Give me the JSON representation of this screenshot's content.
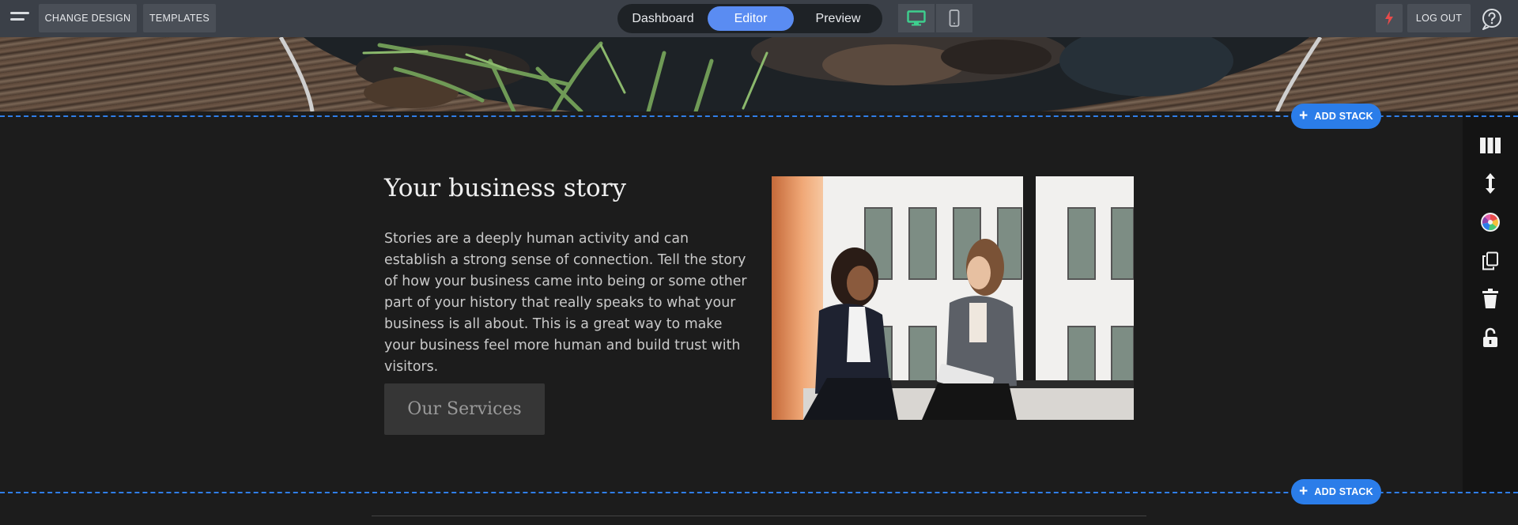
{
  "toolbar": {
    "change_design_label": "CHANGE DESIGN",
    "templates_label": "TEMPLATES",
    "modes": [
      {
        "label": "Dashboard",
        "active": false
      },
      {
        "label": "Editor",
        "active": true
      },
      {
        "label": "Preview",
        "active": false
      }
    ],
    "devices": [
      "desktop-icon",
      "mobile-icon"
    ],
    "active_device": "desktop",
    "logout_label": "LOG OUT",
    "icons": [
      "menu-icon",
      "lightning-icon",
      "help-icon"
    ]
  },
  "stack_controls": {
    "add_stack_label": "ADD STACK"
  },
  "content": {
    "heading": "Your business story",
    "body": "Stories are a deeply human activity and can establish a strong sense of connection. Tell the story of how your business came into being or some other part of your history that really speaks to what your business is all about. This is a great way to make your business feel more human and build trust with visitors.",
    "button_label": "Our Services"
  },
  "side_tools": [
    "columns-icon",
    "resize-vertical-icon",
    "color-wheel-icon",
    "duplicate-icon",
    "trash-icon",
    "unlock-icon"
  ],
  "colors": {
    "toolbar_bg": "#3b4048",
    "accent_blue": "#2b7de9",
    "editor_tab": "#5a8cf2",
    "device_active": "#3ecf8e",
    "lightning": "#e84b4b",
    "section_bg": "#1c1c1c"
  }
}
